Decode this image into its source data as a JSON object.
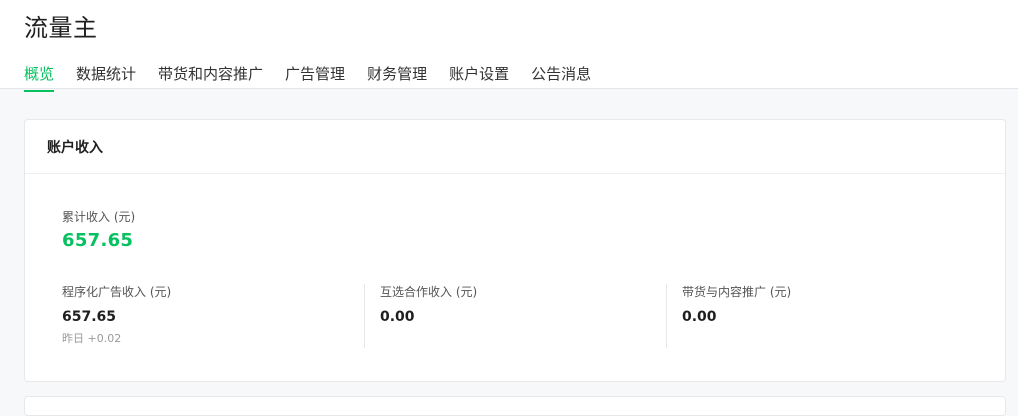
{
  "app": {
    "title": "流量主"
  },
  "tabs": [
    {
      "label": "概览",
      "active": true
    },
    {
      "label": "数据统计",
      "active": false
    },
    {
      "label": "带货和内容推广",
      "active": false
    },
    {
      "label": "广告管理",
      "active": false
    },
    {
      "label": "财务管理",
      "active": false
    },
    {
      "label": "账户设置",
      "active": false
    },
    {
      "label": "公告消息",
      "active": false
    }
  ],
  "income": {
    "title": "账户收入",
    "total_label": "累计收入 (元)",
    "total_value": "657.65",
    "metrics": [
      {
        "label": "程序化广告收入 (元)",
        "value": "657.65",
        "sub": "昨日 +0.02"
      },
      {
        "label": "互选合作收入 (元)",
        "value": "0.00",
        "sub": ""
      },
      {
        "label": "带货与内容推广 (元)",
        "value": "0.00",
        "sub": ""
      }
    ]
  },
  "colors": {
    "accent": "#07c160"
  }
}
